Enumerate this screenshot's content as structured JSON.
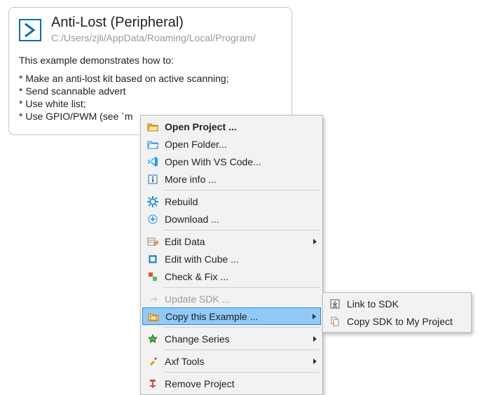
{
  "card": {
    "title": "Anti-Lost (Peripheral)",
    "path": "C:/Users/zjli/AppData/Roaming/Local/Program/",
    "intro": "This example demonstrates how to:",
    "bullets": [
      "* Make an anti-lost kit based on active scanning;",
      "* Send scannable advert",
      "* Use white list;",
      "* Use GPIO/PWM (see `m"
    ]
  },
  "menu": {
    "items": [
      {
        "id": "open-project",
        "label": "Open Project ...",
        "icon": "folder-open-orange",
        "bold": true
      },
      {
        "id": "open-folder",
        "label": "Open Folder...",
        "icon": "folder-open-blue"
      },
      {
        "id": "open-vscode",
        "label": "Open With VS Code...",
        "icon": "vscode"
      },
      {
        "id": "more-info",
        "label": "More info ...",
        "icon": "info"
      },
      {
        "sep": true
      },
      {
        "id": "rebuild",
        "label": "Rebuild",
        "icon": "gear-blue"
      },
      {
        "id": "download",
        "label": "Download ...",
        "icon": "download-blue"
      },
      {
        "sep": true
      },
      {
        "id": "edit-data",
        "label": "Edit Data",
        "icon": "table-pencil",
        "submenu": true
      },
      {
        "id": "edit-cube",
        "label": "Edit with Cube ...",
        "icon": "cube"
      },
      {
        "id": "check-fix",
        "label": "Check & Fix ...",
        "icon": "puzzle"
      },
      {
        "sep": true
      },
      {
        "id": "update-sdk",
        "label": "Update SDK ...",
        "icon": "share-arrow",
        "disabled": true
      },
      {
        "id": "copy-example",
        "label": "Copy this Example ...",
        "icon": "folder-orange",
        "submenu": true,
        "highlight": true
      },
      {
        "sep": true
      },
      {
        "id": "change-series",
        "label": "Change Series",
        "icon": "star-green",
        "submenu": true
      },
      {
        "sep": true
      },
      {
        "id": "axf-tools",
        "label": "Axf Tools",
        "icon": "tools",
        "submenu": true
      },
      {
        "sep": true
      },
      {
        "id": "remove-project",
        "label": "Remove Project",
        "icon": "remove-red"
      }
    ]
  },
  "submenu": {
    "items": [
      {
        "id": "link-sdk",
        "label": "Link to SDK",
        "icon": "link-box"
      },
      {
        "id": "copy-sdk",
        "label": "Copy SDK to My Project",
        "icon": "copy-doc"
      }
    ]
  },
  "colors": {
    "highlight_bg": "#91c9f7",
    "highlight_border": "#2a8dd4",
    "path_gray": "#9a9a9a"
  }
}
